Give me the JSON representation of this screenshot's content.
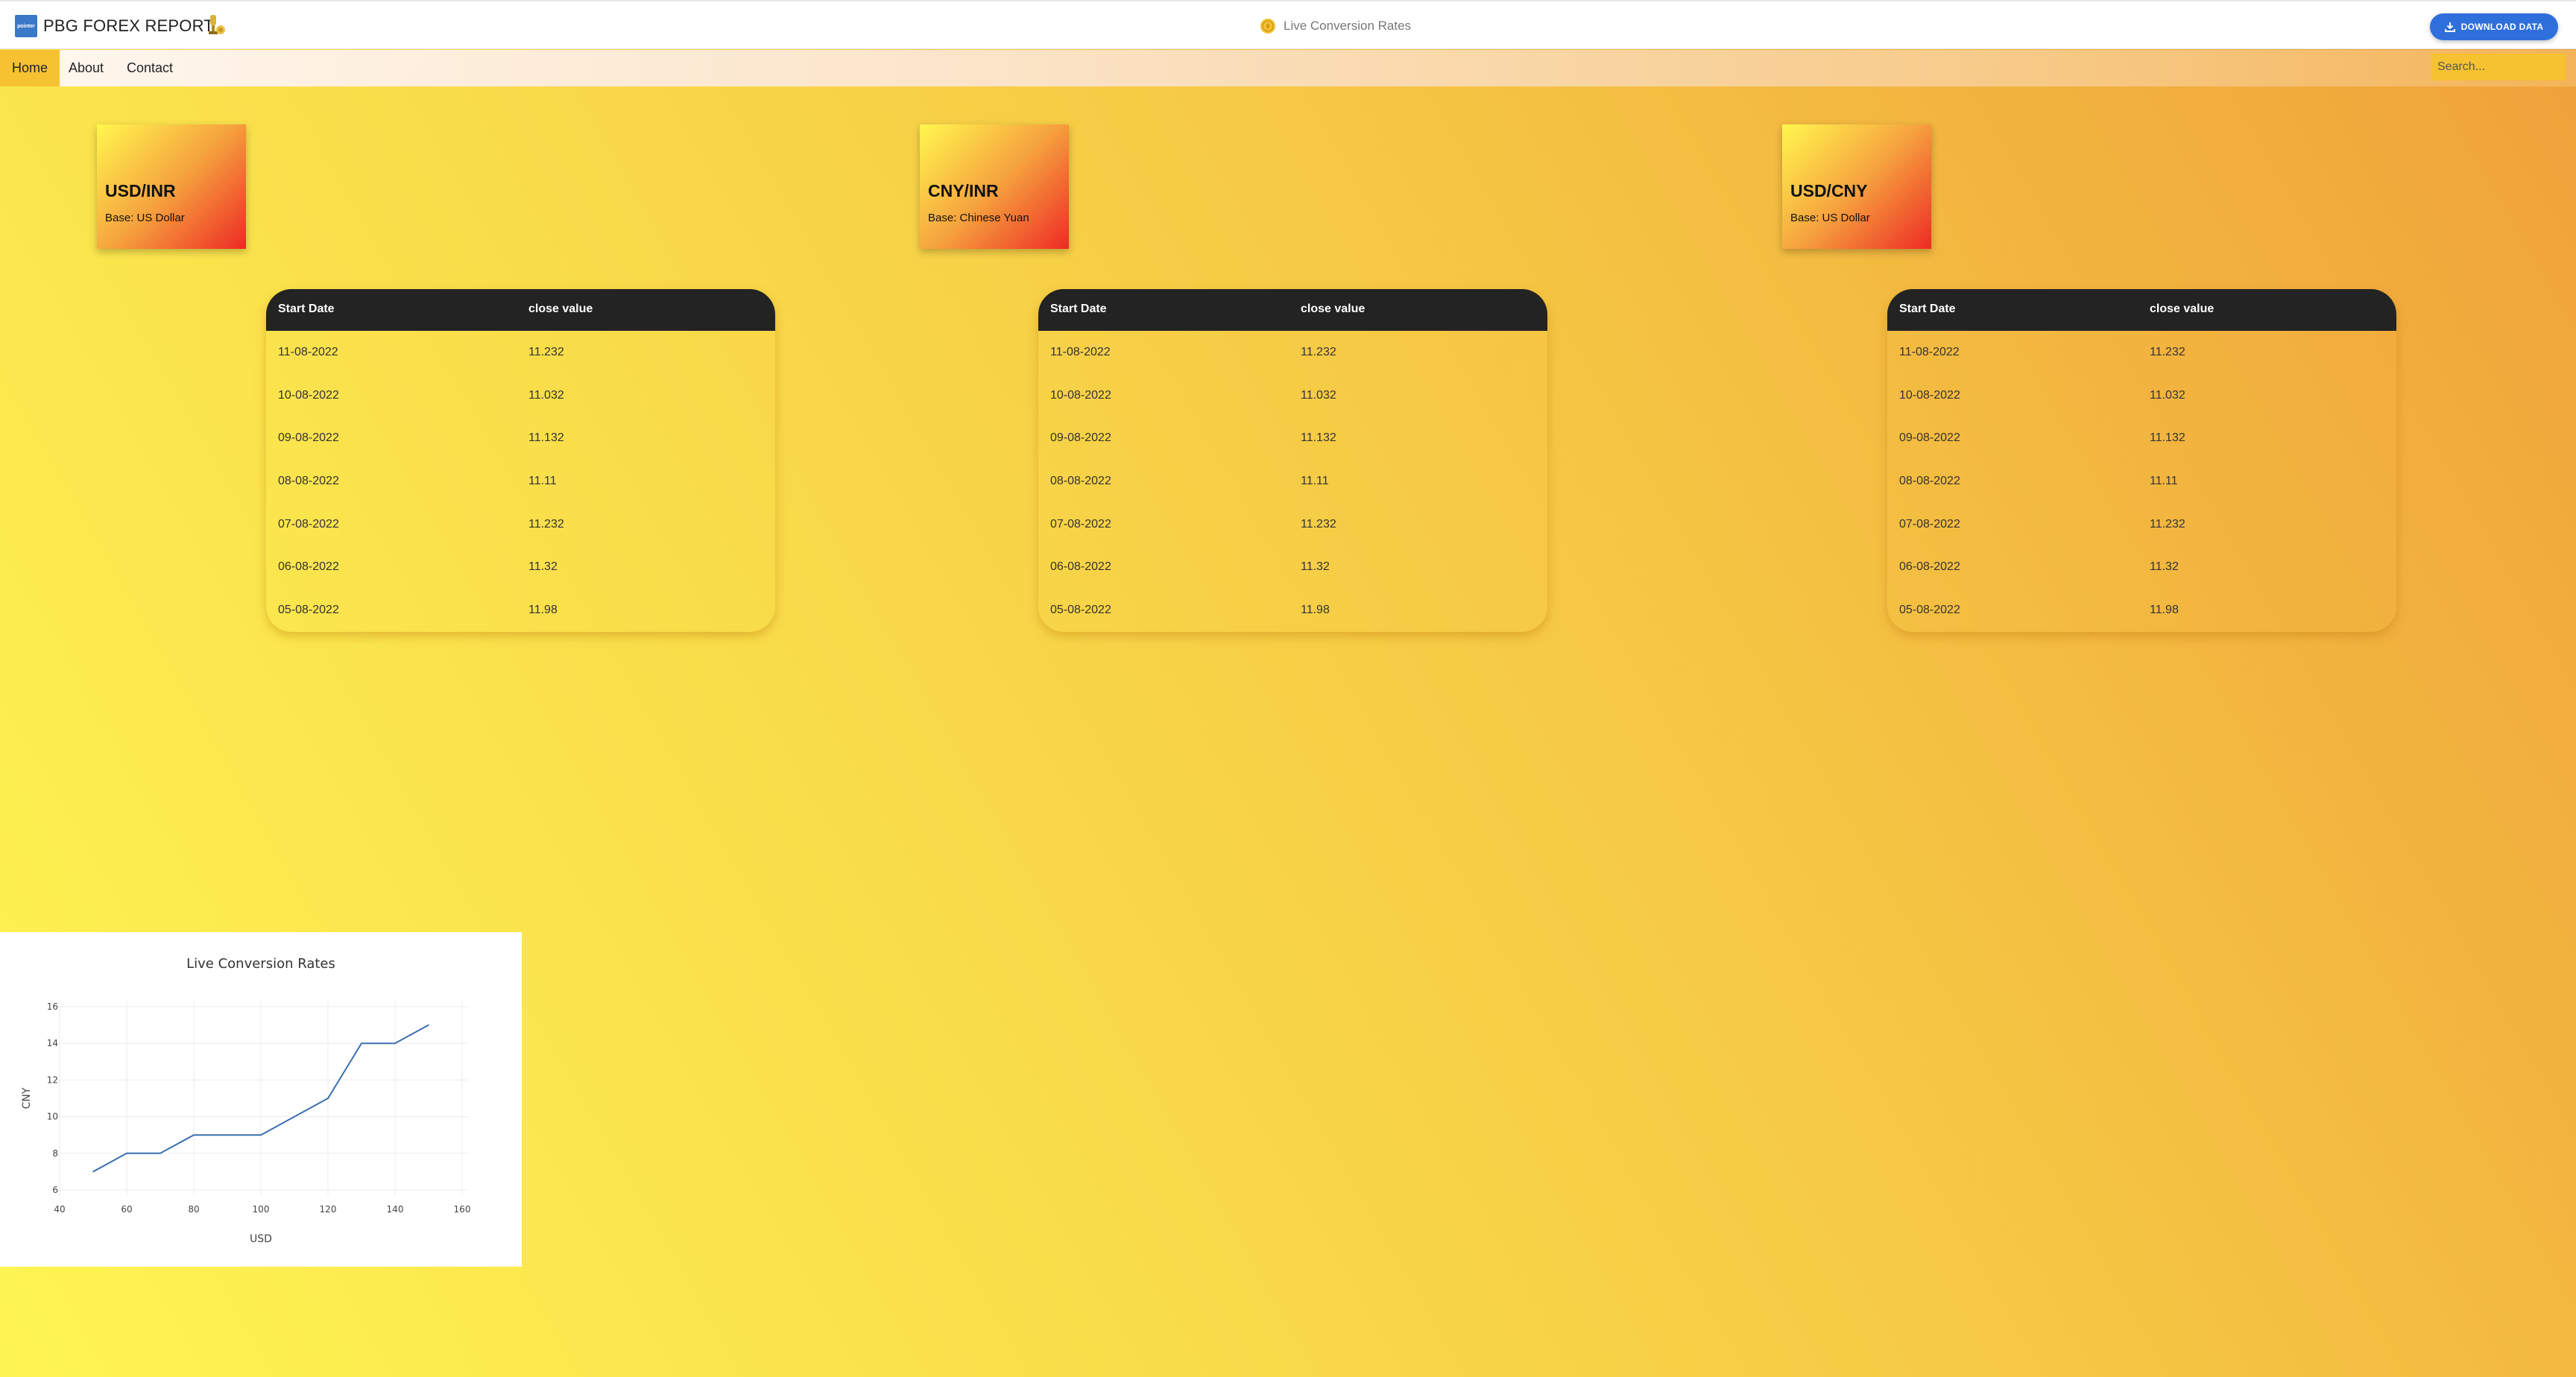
{
  "header": {
    "brand": "PBG FOREX REPORT",
    "logo_text": "pointer",
    "center_title": "Live Conversion Rates",
    "download_label": "DOWNLOAD DATA"
  },
  "nav": {
    "items": [
      {
        "label": "Home",
        "active": true
      },
      {
        "label": "About",
        "active": false
      },
      {
        "label": "Contact",
        "active": false
      }
    ],
    "search_placeholder": "Search..."
  },
  "cards": [
    {
      "pair": "USD/INR",
      "base": "Base: US Dollar"
    },
    {
      "pair": "CNY/INR",
      "base": "Base: Chinese Yuan"
    },
    {
      "pair": "USD/CNY",
      "base": "Base: US Dollar"
    }
  ],
  "tables": [
    {
      "headers": [
        "Start Date",
        "close value"
      ],
      "rows": [
        [
          "11-08-2022",
          "11.232"
        ],
        [
          "10-08-2022",
          "11.032"
        ],
        [
          "09-08-2022",
          "11.132"
        ],
        [
          "08-08-2022",
          "11.11"
        ],
        [
          "07-08-2022",
          "11.232"
        ],
        [
          "06-08-2022",
          "11.32"
        ],
        [
          "05-08-2022",
          "11.98"
        ]
      ]
    },
    {
      "headers": [
        "Start Date",
        "close value"
      ],
      "rows": [
        [
          "11-08-2022",
          "11.232"
        ],
        [
          "10-08-2022",
          "11.032"
        ],
        [
          "09-08-2022",
          "11.132"
        ],
        [
          "08-08-2022",
          "11.11"
        ],
        [
          "07-08-2022",
          "11.232"
        ],
        [
          "06-08-2022",
          "11.32"
        ],
        [
          "05-08-2022",
          "11.98"
        ]
      ]
    },
    {
      "headers": [
        "Start Date",
        "close value"
      ],
      "rows": [
        [
          "11-08-2022",
          "11.232"
        ],
        [
          "10-08-2022",
          "11.032"
        ],
        [
          "09-08-2022",
          "11.132"
        ],
        [
          "08-08-2022",
          "11.11"
        ],
        [
          "07-08-2022",
          "11.232"
        ],
        [
          "06-08-2022",
          "11.32"
        ],
        [
          "05-08-2022",
          "11.98"
        ]
      ]
    }
  ],
  "colors": {
    "accent_blue": "#2f6fdc",
    "table_header": "#232323",
    "line": "#3a6fb0",
    "nav_active": "#f6c232"
  },
  "chart_data": {
    "type": "line",
    "title": "Live Conversion Rates",
    "xlabel": "USD",
    "ylabel": "CNY",
    "x": [
      50,
      60,
      70,
      80,
      90,
      100,
      110,
      120,
      130,
      140,
      150
    ],
    "y": [
      7,
      8,
      8,
      9,
      9,
      9,
      10,
      11,
      14,
      14,
      15
    ],
    "xlim": [
      40,
      160
    ],
    "ylim": [
      6,
      16
    ],
    "xticks": [
      40,
      60,
      80,
      100,
      120,
      140,
      160
    ],
    "yticks": [
      6,
      8,
      10,
      12,
      14,
      16
    ],
    "grid": true,
    "legend": "none"
  }
}
